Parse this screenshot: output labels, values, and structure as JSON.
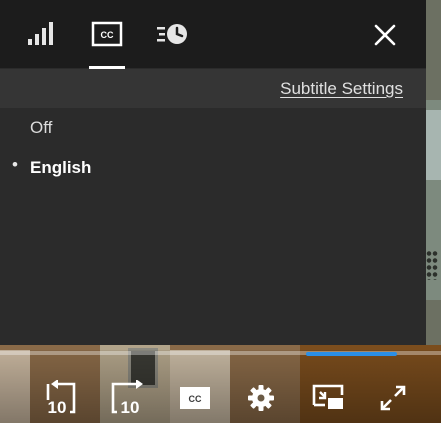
{
  "panel": {
    "tabs": [
      {
        "name": "quality",
        "icon": "signal-bars-icon"
      },
      {
        "name": "subtitles",
        "icon": "closed-captions-icon",
        "badge": "CC",
        "active": true
      },
      {
        "name": "speed",
        "icon": "playback-speed-icon"
      }
    ],
    "close_icon": "close-icon",
    "subtitle_settings_label": "Subtitle Settings",
    "options": [
      {
        "label": "Off",
        "selected": false
      },
      {
        "label": "English",
        "selected": true,
        "bullet": "•"
      }
    ]
  },
  "player": {
    "progress": 0.9,
    "controls": [
      {
        "name": "rewind-10",
        "icon": "rewind-10-icon",
        "label": "10"
      },
      {
        "name": "forward-10",
        "icon": "forward-10-icon",
        "label": "10"
      },
      {
        "name": "captions",
        "icon": "closed-captions-icon",
        "badge": "CC"
      },
      {
        "name": "settings",
        "icon": "gear-icon"
      },
      {
        "name": "picture-in-picture",
        "icon": "picture-in-picture-icon"
      },
      {
        "name": "fullscreen",
        "icon": "fullscreen-icon"
      }
    ]
  },
  "colors": {
    "panel_bg": "#2b2b2b",
    "header_bg": "#1c1c1c",
    "accent": "#2b8fe6",
    "text": "#dcdcdc"
  }
}
